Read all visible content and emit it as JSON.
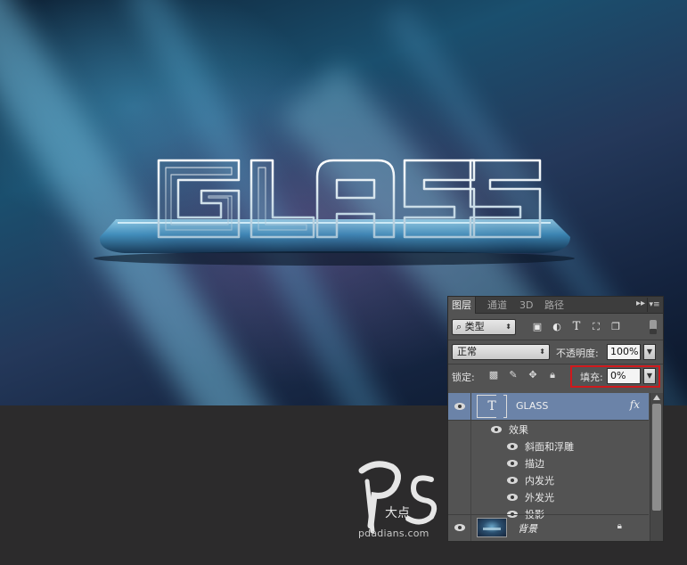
{
  "artwork": {
    "headline": "GLASS",
    "colors": {
      "background_dark": "#0e2236",
      "glow_blue": "#6fb6d6",
      "plinth": "#3f8fbf"
    }
  },
  "watermark": {
    "logo_text": "Ps",
    "logo_subtext": "大点",
    "url": "pdadians.com"
  },
  "layers_panel": {
    "tabs": [
      {
        "label": "图层",
        "active": true
      },
      {
        "label": "通道",
        "active": false
      },
      {
        "label": "3D",
        "active": false
      },
      {
        "label": "路径",
        "active": false
      }
    ],
    "tab_overflow_icon": "double-chevron-right-icon",
    "menu_icon": "panel-menu-icon",
    "filter": {
      "kind_label": "类型",
      "icons": [
        "image-filter-icon",
        "adjustment-filter-icon",
        "type-filter-icon",
        "shape-filter-icon",
        "smart-object-filter-icon"
      ]
    },
    "blend_mode": "正常",
    "opacity_label": "不透明度:",
    "opacity_value": "100%",
    "lock_label": "锁定:",
    "lock_icons": [
      "lock-transparency-icon",
      "lock-pixels-icon",
      "lock-position-icon",
      "lock-all-icon"
    ],
    "fill_label": "填充:",
    "fill_value": "0%",
    "highlight_color": "#d0181c",
    "layers": [
      {
        "name": "GLASS",
        "thumb_glyph": "T",
        "fx": "fx",
        "selected": true,
        "effects_label": "效果",
        "effects": [
          "斜面和浮雕",
          "描边",
          "内发光",
          "外发光",
          "投影"
        ]
      },
      {
        "name": "背景",
        "selected": false,
        "locked": true
      }
    ]
  }
}
